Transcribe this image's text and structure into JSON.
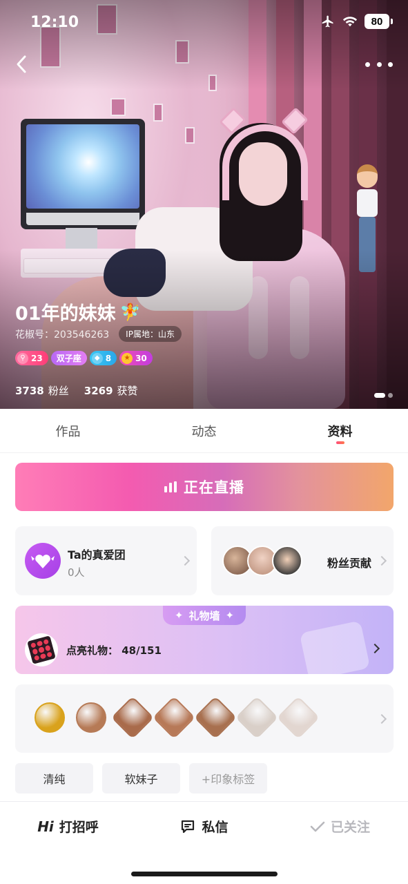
{
  "status_bar": {
    "time": "12:10",
    "battery": "80"
  },
  "profile": {
    "name": "01年的妹妹",
    "id_label": "花椒号：203546263",
    "ip_label": "IP属地：山东",
    "badges": {
      "level": "23",
      "zodiac": "双子座",
      "diamond": "8",
      "star": "30"
    },
    "stats": {
      "fans_value": "3738",
      "fans_label": "粉丝",
      "likes_value": "3269",
      "likes_label": "获赞"
    }
  },
  "tabs": [
    {
      "label": "作品"
    },
    {
      "label": "动态"
    },
    {
      "label": "资料"
    }
  ],
  "active_tab": "资料",
  "live_banner": {
    "label": "正在直播"
  },
  "fanclub": {
    "title": "Ta的真爱团",
    "count": "0人"
  },
  "contribution": {
    "label": "粉丝贡献"
  },
  "gift_wall": {
    "tab_label": "礼物墙",
    "progress_text": "点亮礼物：  48/151",
    "lit": 48,
    "total": 151
  },
  "medals": [
    {
      "icon": "gold-medal-icon",
      "color": "#d9a21c"
    },
    {
      "icon": "bronze-medal-icon",
      "color": "#b67a56"
    },
    {
      "icon": "bronze-medal-icon",
      "color": "#a96b4b"
    },
    {
      "icon": "bronze-medal-icon",
      "color": "#b77958"
    },
    {
      "icon": "bronze-medal-icon",
      "color": "#a8704f"
    },
    {
      "icon": "silver-medal-icon",
      "color": "#d9cfc8"
    },
    {
      "icon": "silver-medal-icon",
      "color": "#e2d6d0"
    }
  ],
  "tags": [
    {
      "label": "清纯"
    },
    {
      "label": "软妹子"
    },
    {
      "label": "+印象标签"
    }
  ],
  "bottom_bar": {
    "greet_icon": "Hi",
    "greet": "打招呼",
    "message": "私信",
    "follow": "已关注"
  },
  "colors": {
    "accent": "#ff4d7a",
    "live_gradient_start": "#ff7db7",
    "fanclub_purple": "#b34ef0"
  }
}
